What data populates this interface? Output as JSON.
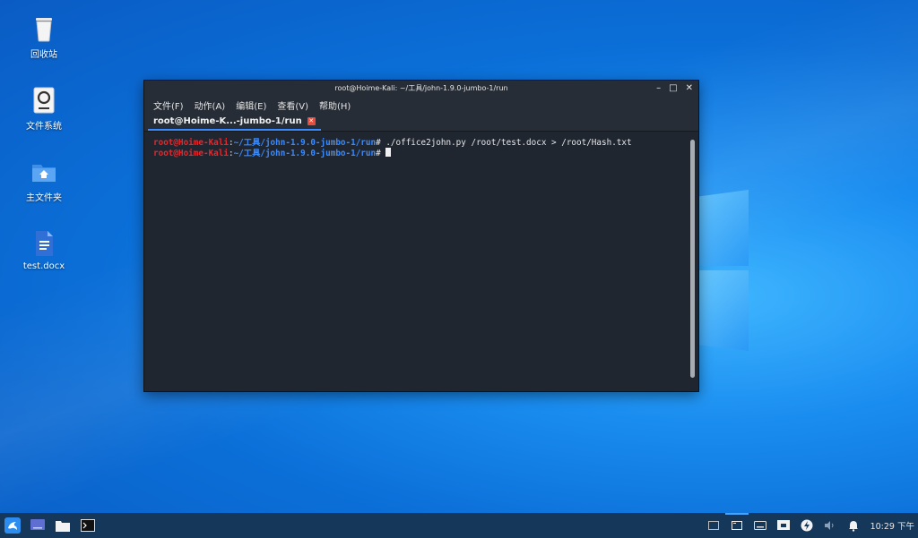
{
  "desktop": {
    "icons": [
      {
        "label": "回收站",
        "icon": "trash-icon"
      },
      {
        "label": "文件系统",
        "icon": "drive-icon"
      },
      {
        "label": "主文件夹",
        "icon": "home-folder-icon"
      },
      {
        "label": "test.docx",
        "icon": "document-icon"
      }
    ]
  },
  "terminal": {
    "title": "root@Hoime-Kali: ~/工具/john-1.9.0-jumbo-1/run",
    "menu": [
      "文件(F)",
      "动作(A)",
      "编辑(E)",
      "查看(V)",
      "帮助(H)"
    ],
    "tab_label": "root@Hoime-K...-jumbo-1/run",
    "lines": [
      {
        "user": "root@Hoime-Kali",
        "sep": ":",
        "path": "~/工具/john-1.9.0-jumbo-1/run",
        "prompt": "#",
        "cmd": " ./office2john.py /root/test.docx > /root/Hash.txt"
      },
      {
        "user": "root@Hoime-Kali",
        "sep": ":",
        "path": "~/工具/john-1.9.0-jumbo-1/run",
        "prompt": "#",
        "cmd": " "
      }
    ]
  },
  "taskbar": {
    "clock": "10:29 下午"
  },
  "colors": {
    "accent": "#3a8bff",
    "user_red": "#e8262b",
    "terminal_bg": "#1f2630"
  }
}
